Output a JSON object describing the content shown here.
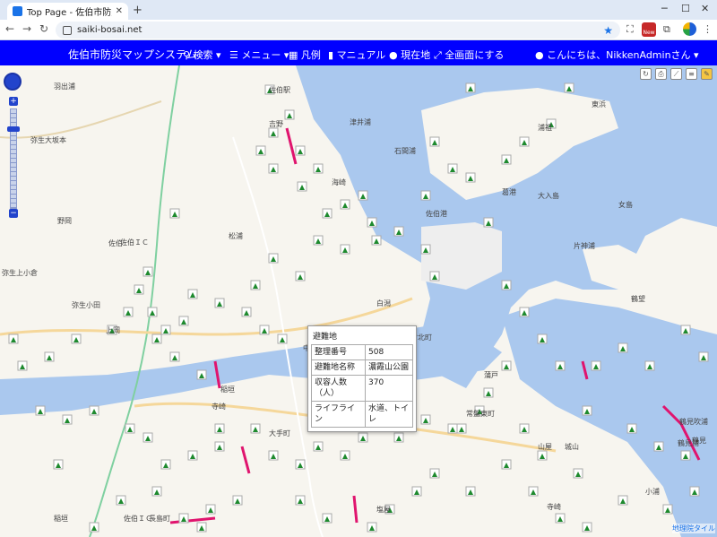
{
  "browser": {
    "tab_title": "Top Page - 佐伯市防災マップシステ",
    "url": "saiki-bosai.net",
    "new_badge": "New"
  },
  "appnav": {
    "brand": "佐伯市防災マップシステム",
    "menu": [
      {
        "label": "検索 ▾"
      },
      {
        "label": "メニュー ▾"
      },
      {
        "label": "凡例"
      },
      {
        "label": "マニュアル"
      },
      {
        "label": "現在地"
      },
      {
        "label": "全画面にする"
      }
    ],
    "user_greeting": "こんにちは、NikkenAdminさん ▾"
  },
  "map": {
    "labels": [
      "弥生大坂本",
      "野岡",
      "佐伯ＩＣ",
      "弥生上小倉",
      "佐伯",
      "弥生小田",
      "上岡",
      "稲垣",
      "長島町",
      "中村北町",
      "佐伯ＩＣ",
      "寺崎",
      "鶴見吹浦",
      "鶴見",
      "羽出浦",
      "大入島",
      "東浜",
      "石間浦",
      "浦祖",
      "吉野",
      "蒲戸",
      "塩屋",
      "佐伯港",
      "葛港",
      "片神浦",
      "女島",
      "鶴望",
      "常盤東町",
      "山屋",
      "津井浦",
      "城山",
      "稲垣",
      "海崎",
      "松浦",
      "中江",
      "寺崎",
      "鶴見浦",
      "佐伯駅",
      "小浦",
      "白潟",
      "大手町"
    ],
    "attribution": "地理院タイル"
  },
  "popup": {
    "title": "避難地",
    "rows": [
      {
        "key": "整理番号",
        "value": "508"
      },
      {
        "key": "避難地名称",
        "value": "濃霞山公園"
      },
      {
        "key": "収容人数（人）",
        "value": "370"
      },
      {
        "key": "ライフライン",
        "value": "水道、トイレ"
      }
    ]
  },
  "colors": {
    "nav_bg": "#0000ff",
    "water": "#aac8ee",
    "marker": "#1e8a2e",
    "hazard": "#e0146e"
  }
}
